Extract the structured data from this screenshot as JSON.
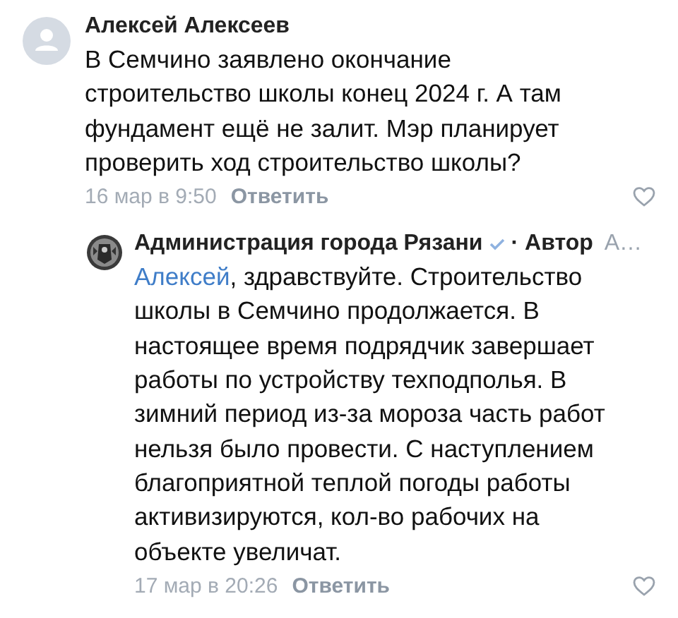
{
  "comments": [
    {
      "kind": "comment",
      "author": "Алексей Алексеев",
      "verified": false,
      "text": "В Семчино заявлено окончание\nстроительство школы конец 2024 г. А там\nфундамент ещё не залит. Мэр планирует\nпроверить ход строительство школы?",
      "date": "16 мар в 9:50",
      "reply_label": "Ответить",
      "liked": false
    },
    {
      "kind": "reply",
      "author": "Администрация города Рязани",
      "verified": true,
      "role": "· Автор",
      "extra": "А…",
      "mention": "Алексей",
      "text": ", здравствуйте. Строительство\nшколы в Семчино продолжается. В\nнастоящее время подрядчик завершает\nработы по устройству техподполья. В\nзимний период из-за мороза часть работ\nнельзя было провести. С наступлением\nблагоприятной теплой погоды работы\nактивизируются, кол-во рабочих на\nобъекте увеличат.",
      "date": "17 мар в 20:26",
      "reply_label": "Ответить",
      "liked": false
    }
  ]
}
